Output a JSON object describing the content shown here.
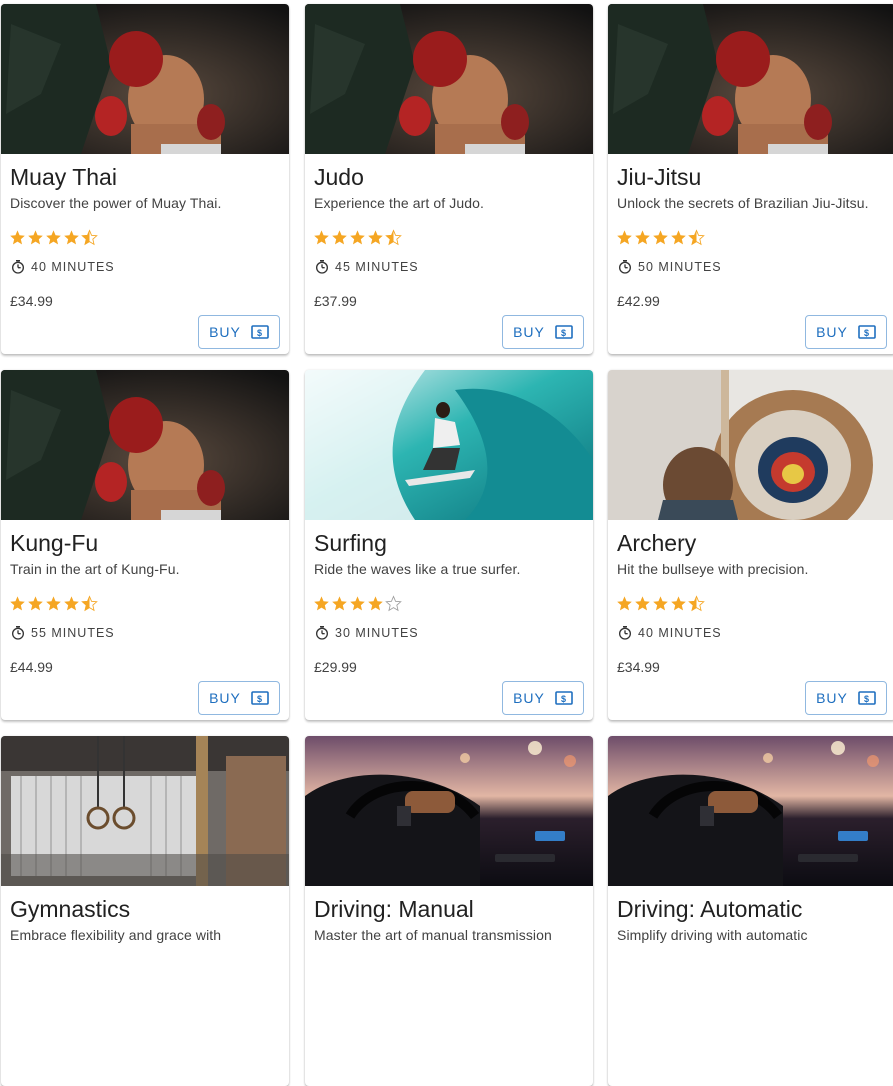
{
  "colors": {
    "star": "#f5a623",
    "star_empty": "#9e9e9e",
    "buy_text": "#1f6fbf",
    "buy_border": "#90b8e0"
  },
  "icons": {
    "rating": "star-icon",
    "duration": "timer-icon",
    "buy": "cash-icon"
  },
  "courses": [
    {
      "title": "Muay Thai",
      "description": "Discover the power of Muay Thai.",
      "rating": 4.5,
      "duration": "40 MINUTES",
      "price": "£34.99",
      "buy_label": "BUY",
      "image": "boxing"
    },
    {
      "title": "Judo",
      "description": "Experience the art of Judo.",
      "rating": 4.5,
      "duration": "45 MINUTES",
      "price": "£37.99",
      "buy_label": "BUY",
      "image": "boxing"
    },
    {
      "title": "Jiu-Jitsu",
      "description": "Unlock the secrets of Brazilian Jiu-Jitsu.",
      "rating": 4.5,
      "duration": "50 MINUTES",
      "price": "£42.99",
      "buy_label": "BUY",
      "image": "boxing"
    },
    {
      "title": "Kung-Fu",
      "description": "Train in the art of Kung-Fu.",
      "rating": 4.5,
      "duration": "55 MINUTES",
      "price": "£44.99",
      "buy_label": "BUY",
      "image": "boxing"
    },
    {
      "title": "Surfing",
      "description": "Ride the waves like a true surfer.",
      "rating": 4,
      "duration": "30 MINUTES",
      "price": "£29.99",
      "buy_label": "BUY",
      "image": "surf"
    },
    {
      "title": "Archery",
      "description": "Hit the bullseye with precision.",
      "rating": 4.5,
      "duration": "40 MINUTES",
      "price": "£34.99",
      "buy_label": "BUY",
      "image": "archery"
    },
    {
      "title": "Gymnastics",
      "description": "Embrace flexibility and grace with",
      "image": "gym"
    },
    {
      "title": "Driving: Manual",
      "description": "Master the art of manual transmission",
      "image": "car"
    },
    {
      "title": "Driving: Automatic",
      "description": "Simplify driving with automatic",
      "image": "car"
    }
  ]
}
